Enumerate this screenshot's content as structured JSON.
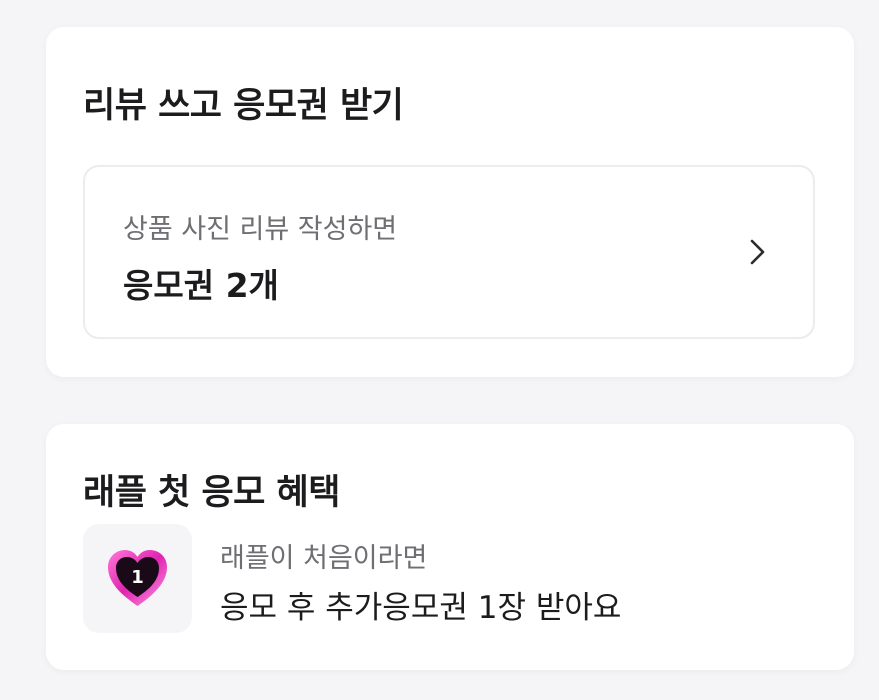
{
  "review_section": {
    "title": "리뷰 쓰고 응모권 받기",
    "row": {
      "subtitle": "상품 사진 리뷰 작성하면",
      "main": "응모권 2개"
    }
  },
  "raffle_section": {
    "title": "래플 첫 응모 혜택",
    "icon": "heart-number-1-icon",
    "badge_number": "1",
    "subtitle": "래플이 처음이라면",
    "main": "응모 후 추가응모권 1장 받아요"
  }
}
